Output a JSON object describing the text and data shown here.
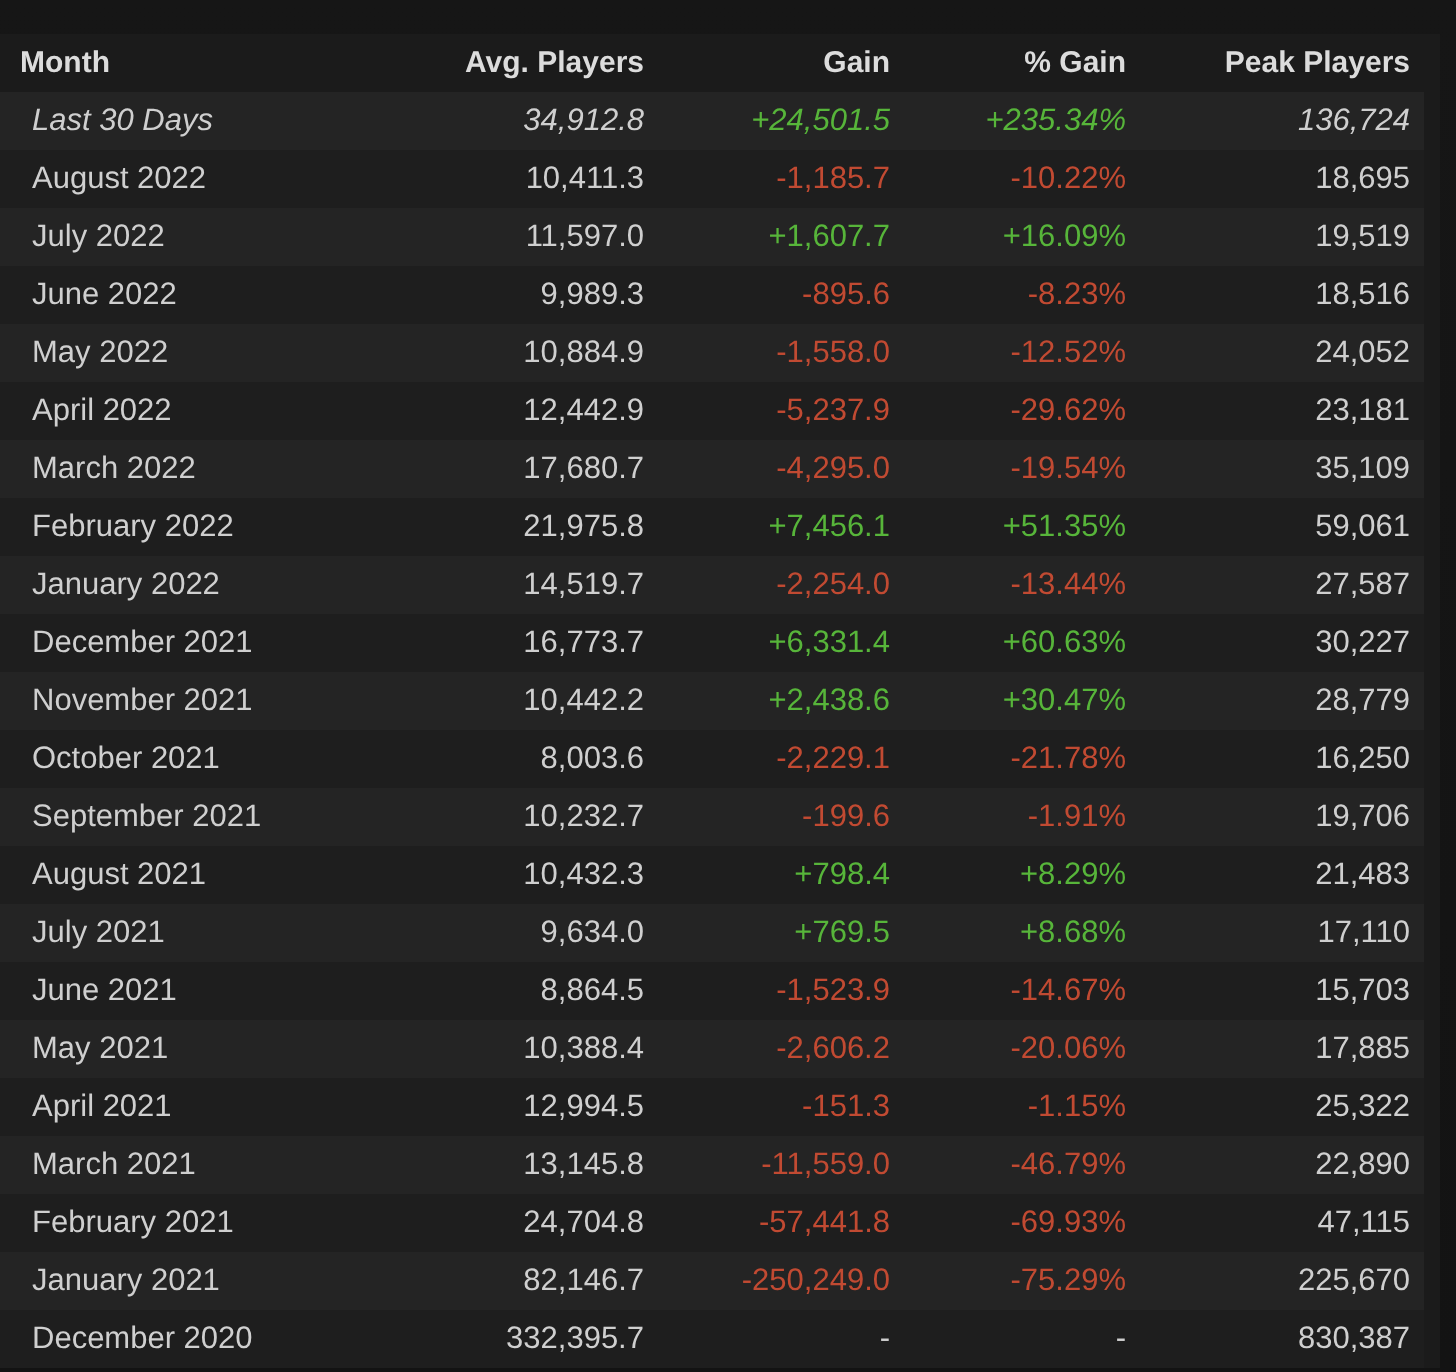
{
  "table": {
    "columns": [
      "Month",
      "Avg. Players",
      "Gain",
      "% Gain",
      "Peak Players"
    ],
    "rows": [
      {
        "kind": "current",
        "color": "#57b53a",
        "month": "Last 30 Days",
        "avg": "34,912.8",
        "gain": "+24,501.5",
        "pct": "+235.34%",
        "peak": "136,724"
      },
      {
        "kind": "month",
        "color": "#c14a32",
        "month": "August 2022",
        "avg": "10,411.3",
        "gain": "-1,185.7",
        "pct": "-10.22%",
        "peak": "18,695"
      },
      {
        "kind": "month",
        "color": "#57b53a",
        "month": "July 2022",
        "avg": "11,597.0",
        "gain": "+1,607.7",
        "pct": "+16.09%",
        "peak": "19,519"
      },
      {
        "kind": "month",
        "color": "#c14a32",
        "month": "June 2022",
        "avg": "9,989.3",
        "gain": "-895.6",
        "pct": "-8.23%",
        "peak": "18,516"
      },
      {
        "kind": "month",
        "color": "#c14a32",
        "month": "May 2022",
        "avg": "10,884.9",
        "gain": "-1,558.0",
        "pct": "-12.52%",
        "peak": "24,052"
      },
      {
        "kind": "month",
        "color": "#c14a32",
        "month": "April 2022",
        "avg": "12,442.9",
        "gain": "-5,237.9",
        "pct": "-29.62%",
        "peak": "23,181"
      },
      {
        "kind": "month",
        "color": "#c14a32",
        "month": "March 2022",
        "avg": "17,680.7",
        "gain": "-4,295.0",
        "pct": "-19.54%",
        "peak": "35,109"
      },
      {
        "kind": "month",
        "color": "#57b53a",
        "month": "February 2022",
        "avg": "21,975.8",
        "gain": "+7,456.1",
        "pct": "+51.35%",
        "peak": "59,061"
      },
      {
        "kind": "month",
        "color": "#c14a32",
        "month": "January 2022",
        "avg": "14,519.7",
        "gain": "-2,254.0",
        "pct": "-13.44%",
        "peak": "27,587"
      },
      {
        "kind": "month",
        "color": "#57b53a",
        "month": "December 2021",
        "avg": "16,773.7",
        "gain": "+6,331.4",
        "pct": "+60.63%",
        "peak": "30,227"
      },
      {
        "kind": "month",
        "color": "#57b53a",
        "month": "November 2021",
        "avg": "10,442.2",
        "gain": "+2,438.6",
        "pct": "+30.47%",
        "peak": "28,779"
      },
      {
        "kind": "month",
        "color": "#c14a32",
        "month": "October 2021",
        "avg": "8,003.6",
        "gain": "-2,229.1",
        "pct": "-21.78%",
        "peak": "16,250"
      },
      {
        "kind": "month",
        "color": "#c14a32",
        "month": "September 2021",
        "avg": "10,232.7",
        "gain": "-199.6",
        "pct": "-1.91%",
        "peak": "19,706"
      },
      {
        "kind": "month",
        "color": "#57b53a",
        "month": "August 2021",
        "avg": "10,432.3",
        "gain": "+798.4",
        "pct": "+8.29%",
        "peak": "21,483"
      },
      {
        "kind": "month",
        "color": "#57b53a",
        "month": "July 2021",
        "avg": "9,634.0",
        "gain": "+769.5",
        "pct": "+8.68%",
        "peak": "17,110"
      },
      {
        "kind": "month",
        "color": "#c14a32",
        "month": "June 2021",
        "avg": "8,864.5",
        "gain": "-1,523.9",
        "pct": "-14.67%",
        "peak": "15,703"
      },
      {
        "kind": "month",
        "color": "#c14a32",
        "month": "May 2021",
        "avg": "10,388.4",
        "gain": "-2,606.2",
        "pct": "-20.06%",
        "peak": "17,885"
      },
      {
        "kind": "month",
        "color": "#c14a32",
        "month": "April 2021",
        "avg": "12,994.5",
        "gain": "-151.3",
        "pct": "-1.15%",
        "peak": "25,322"
      },
      {
        "kind": "month",
        "color": "#c14a32",
        "month": "March 2021",
        "avg": "13,145.8",
        "gain": "-11,559.0",
        "pct": "-46.79%",
        "peak": "22,890"
      },
      {
        "kind": "month",
        "color": "#c14a32",
        "month": "February 2021",
        "avg": "24,704.8",
        "gain": "-57,441.8",
        "pct": "-69.93%",
        "peak": "47,115"
      },
      {
        "kind": "month",
        "color": "#c14a32",
        "month": "January 2021",
        "avg": "82,146.7",
        "gain": "-250,249.0",
        "pct": "-75.29%",
        "peak": "225,670"
      },
      {
        "kind": "month",
        "color": "#cfcfcf",
        "month": "December 2020",
        "avg": "332,395.7",
        "gain": "-",
        "pct": "-",
        "peak": "830,387"
      }
    ]
  }
}
